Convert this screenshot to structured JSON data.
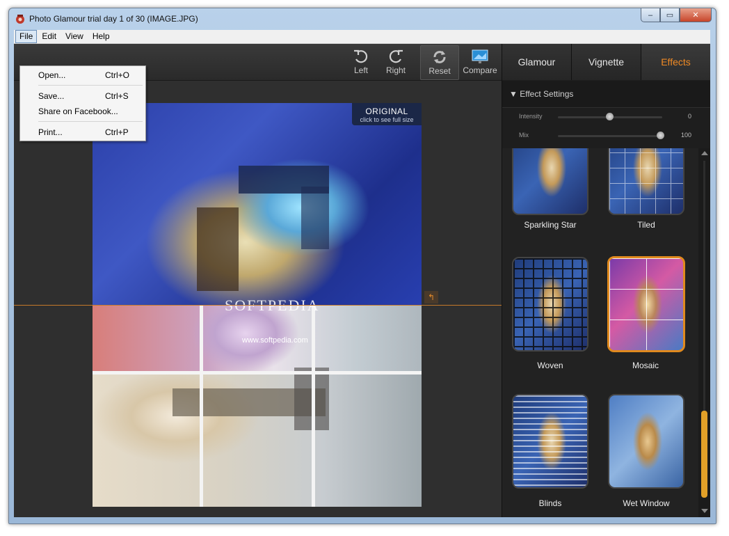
{
  "window": {
    "title": "Photo Glamour trial day 1 of 30 (IMAGE.JPG)",
    "minimize": "‒",
    "maximize": "▭",
    "close": "✕"
  },
  "menubar": {
    "file": "File",
    "edit": "Edit",
    "view": "View",
    "help": "Help"
  },
  "file_menu": [
    {
      "label": "Open...",
      "shortcut": "Ctrl+O"
    },
    {
      "label": "Save...",
      "shortcut": "Ctrl+S"
    },
    {
      "label": "Share on Facebook...",
      "shortcut": ""
    },
    {
      "label": "Print...",
      "shortcut": "Ctrl+P"
    }
  ],
  "toolbar": {
    "left": "Left",
    "right": "Right",
    "reset": "Reset",
    "compare": "Compare"
  },
  "preview": {
    "original_label": "ORIGINAL",
    "original_hint": "click to see full size",
    "watermark": "SOFTPEDIA",
    "watermark_url": "www.softpedia.com"
  },
  "tabs": {
    "glamour": "Glamour",
    "vignette": "Vignette",
    "effects": "Effects",
    "active": "Effects"
  },
  "effect_settings": {
    "header": "Effect Settings",
    "intensity": {
      "label": "Intensity",
      "value": "0"
    },
    "mix": {
      "label": "Mix",
      "value": "100"
    }
  },
  "effects": [
    {
      "name": "Sparkling Star"
    },
    {
      "name": "Tiled"
    },
    {
      "name": "Woven"
    },
    {
      "name": "Mosaic",
      "selected": true
    },
    {
      "name": "Blinds"
    },
    {
      "name": "Wet Window"
    }
  ],
  "colors": {
    "accent": "#f08a24",
    "selected_border": "#e08a1e",
    "scrollbar_thumb": "#e2a028"
  }
}
